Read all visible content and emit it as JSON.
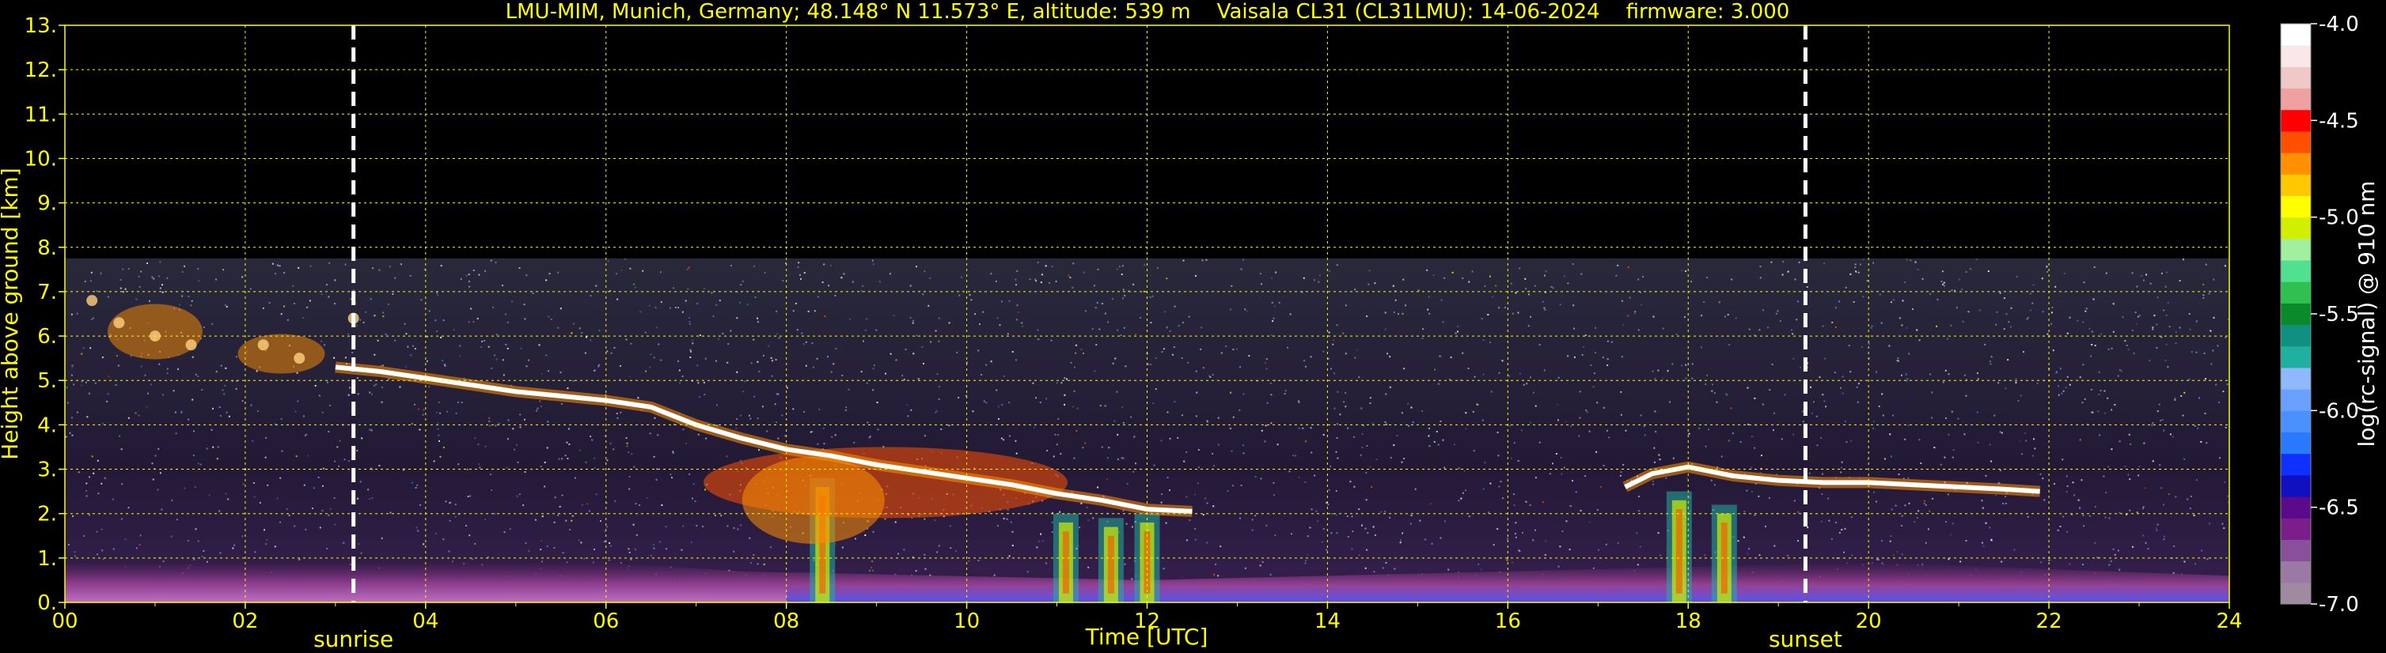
{
  "chart_data": {
    "type": "heatmap",
    "title": "LMU-MIM, Munich, Germany; 48.148° N 11.573° E, altitude: 539 m    Vaisala CL31 (CL31LMU): 14-06-2024    firmware: 3.000",
    "xlabel": "Time [UTC]",
    "ylabel": "Height above ground [km]",
    "xlim": [
      0,
      24
    ],
    "ylim": [
      0,
      13
    ],
    "x_ticks": [
      "00",
      "02",
      "04",
      "06",
      "08",
      "10",
      "12",
      "14",
      "16",
      "18",
      "20",
      "22",
      "24"
    ],
    "y_ticks": [
      "0.",
      "1.",
      "2.",
      "3.",
      "4.",
      "5.",
      "6.",
      "7.",
      "8.",
      "9.",
      "10.",
      "11.",
      "12.",
      "13."
    ],
    "grid": true,
    "markers": [
      {
        "label": "sunrise",
        "x": 3.2
      },
      {
        "label": "sunset",
        "x": 19.3
      }
    ],
    "colorbar": {
      "label": "log(rc-signal) @ 910 nm",
      "range": [
        -7.0,
        -4.0
      ],
      "ticks": [
        "-4.0",
        "-4.5",
        "-5.0",
        "-5.5",
        "-6.0",
        "-6.5",
        "-7.0"
      ],
      "colors": [
        "#a08aa0",
        "#9a7aa5",
        "#8a4f9a",
        "#7a1f8a",
        "#5a0a8a",
        "#1010c0",
        "#1030ff",
        "#2a7aff",
        "#4a90ff",
        "#6aa0ff",
        "#90b8ff",
        "#20b0a0",
        "#109080",
        "#0a8a2a",
        "#30c050",
        "#50e090",
        "#a0f0a0",
        "#d0f000",
        "#ffff00",
        "#ffc800",
        "#ff9000",
        "#ff5000",
        "#ff0000",
        "#f0a0a0",
        "#f0c8c8",
        "#f8e8e8",
        "#ffffff"
      ]
    },
    "signal_top_km": 7.75,
    "cloud_layer": {
      "x": [
        3.0,
        3.5,
        4.0,
        4.5,
        5.0,
        5.5,
        6.0,
        6.5,
        7.0,
        7.5,
        8.0,
        8.5,
        9.0,
        9.5,
        10.0,
        10.5,
        11.0,
        11.5,
        12.0,
        12.5
      ],
      "y": [
        5.3,
        5.2,
        5.05,
        4.9,
        4.75,
        4.65,
        4.55,
        4.4,
        4.0,
        3.7,
        3.45,
        3.3,
        3.1,
        2.95,
        2.8,
        2.65,
        2.45,
        2.3,
        2.1,
        2.05
      ]
    },
    "evening_cloud_layer": {
      "x": [
        17.3,
        17.6,
        18.0,
        18.5,
        19.0,
        19.5,
        20.0,
        20.5,
        21.0,
        21.5,
        21.9
      ],
      "y": [
        2.6,
        2.9,
        3.05,
        2.85,
        2.75,
        2.7,
        2.7,
        2.65,
        2.6,
        2.55,
        2.5
      ]
    },
    "early_cloud": {
      "x": [
        0.3,
        0.6,
        1.0,
        1.4,
        2.2,
        2.6,
        3.2
      ],
      "y": [
        6.8,
        6.3,
        6.0,
        5.8,
        5.8,
        5.5,
        6.4
      ]
    },
    "fallstreaks": [
      {
        "x": 8.4,
        "top": 2.8
      },
      {
        "x": 11.1,
        "top": 2.0
      },
      {
        "x": 11.6,
        "top": 1.9
      },
      {
        "x": 12.0,
        "top": 2.0
      },
      {
        "x": 17.9,
        "top": 2.5
      },
      {
        "x": 18.4,
        "top": 2.2
      }
    ],
    "boundary_layer_km": [
      {
        "x": 0,
        "y": 0.9
      },
      {
        "x": 6,
        "y": 0.9
      },
      {
        "x": 7.5,
        "y": 0.7
      },
      {
        "x": 12,
        "y": 0.5
      },
      {
        "x": 16,
        "y": 0.7
      },
      {
        "x": 20,
        "y": 0.9
      },
      {
        "x": 24,
        "y": 0.6
      }
    ]
  }
}
